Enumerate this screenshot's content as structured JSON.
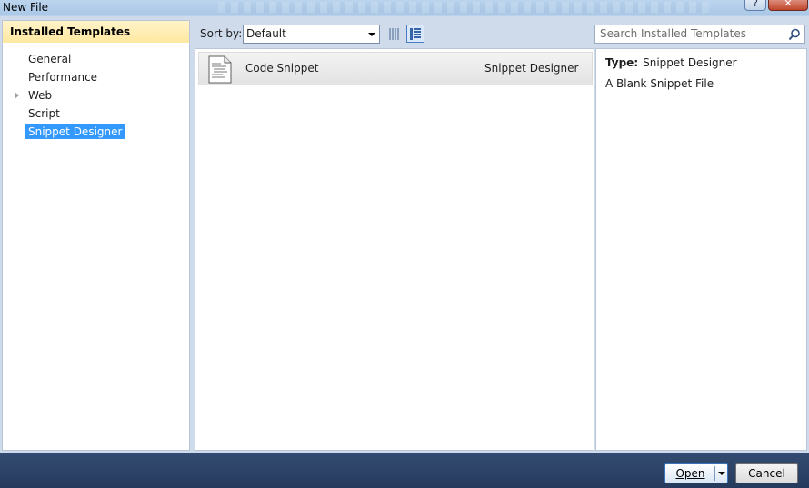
{
  "window": {
    "title": "New File",
    "help_label": "?",
    "close_label": "✕"
  },
  "sidebar": {
    "header": "Installed Templates",
    "items": [
      {
        "label": "General"
      },
      {
        "label": "Performance"
      },
      {
        "label": "Web",
        "expandable": true
      },
      {
        "label": "Script"
      },
      {
        "label": "Snippet Designer",
        "selected": true
      }
    ]
  },
  "toolbar": {
    "sort_label": "Sort by:",
    "sort_value": "Default",
    "search_placeholder": "Search Installed Templates"
  },
  "templates": [
    {
      "name": "Code Snippet",
      "type": "Snippet Designer",
      "icon": "document-icon"
    }
  ],
  "details": {
    "type_label": "Type:",
    "type_value": "Snippet Designer",
    "description": "A Blank Snippet File"
  },
  "footer": {
    "open_label": "Open",
    "cancel_label": "Cancel"
  },
  "colors": {
    "selection": "#3399ff",
    "header_bg": "#ffe8a0",
    "footer_bg": "#2a3f62"
  }
}
